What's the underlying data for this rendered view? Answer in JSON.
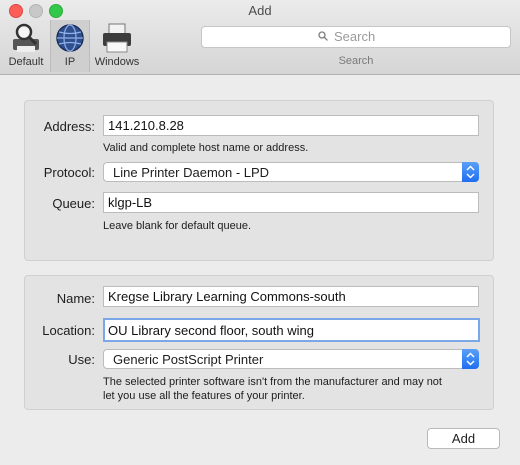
{
  "window": {
    "title": "Add"
  },
  "toolbar": {
    "tabs": [
      {
        "label": "Default",
        "icon": "magnifier-printer-icon",
        "selected": false
      },
      {
        "label": "IP",
        "icon": "globe-icon",
        "selected": true
      },
      {
        "label": "Windows",
        "icon": "printer-icon",
        "selected": false
      }
    ],
    "search": {
      "placeholder": "Search",
      "caption": "Search"
    }
  },
  "connection": {
    "address_label": "Address:",
    "address_value": "141.210.8.28",
    "address_hint": "Valid and complete host name or address.",
    "protocol_label": "Protocol:",
    "protocol_value": "Line Printer Daemon - LPD",
    "queue_label": "Queue:",
    "queue_value": "klgp-LB",
    "queue_hint": "Leave blank for default queue."
  },
  "printer": {
    "name_label": "Name:",
    "name_value": "Kregse Library Learning Commons-south",
    "location_label": "Location:",
    "location_value": "OU Library second floor, south wing",
    "use_label": "Use:",
    "use_value": "Generic PostScript Printer",
    "warning_line1": "The selected printer software isn't from the manufacturer and may not",
    "warning_line2": "let you use all the features of your printer."
  },
  "actions": {
    "add_label": "Add"
  },
  "colors": {
    "accent": "#2a76f2",
    "focus_ring": "#7aa7e8"
  }
}
